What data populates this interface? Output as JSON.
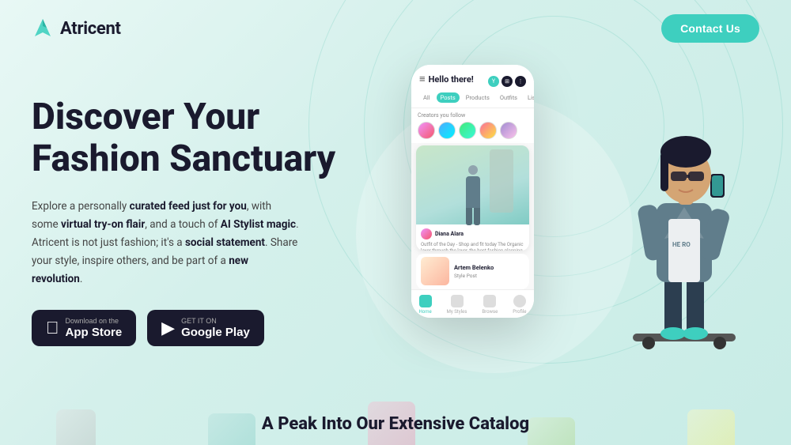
{
  "navbar": {
    "logo_text": "Atricent",
    "contact_button": "Contact Us"
  },
  "hero": {
    "title_line1": "Discover Your",
    "title_line2": "Fashion Sanctuary",
    "description": "Explore a personally curated feed just for you, with some virtual try-on flair, and a touch of AI Stylist magic. Atricent is not just fashion; it's a social statement. Share your style, inspire others, and be part of a new revolution.",
    "description_bold": [
      "curated feed just for you",
      "virtual try-on flair",
      "AI Stylist magic",
      "social statement",
      "new revolution"
    ]
  },
  "store_buttons": {
    "app_store": {
      "pre_label": "Download on the",
      "name": "App Store"
    },
    "google_play": {
      "pre_label": "GET IT ON",
      "name": "Google Play"
    }
  },
  "phone": {
    "greeting": "Hello there!",
    "tabs": [
      "All",
      "Posts",
      "Products",
      "Outfits",
      "List"
    ],
    "active_tab": "Posts",
    "creators_label": "Creators you follow",
    "post_user": "Diana Alara",
    "post_caption": "Outfit of the Day - Shop and fit today The Organic layer through the layer, the best fashion planning your Home harmony",
    "post_user2": "Artem Belenko"
  },
  "bottom": {
    "catalog_heading": "A Peak Into Our Extensive Catalog"
  },
  "colors": {
    "teal": "#3ecfbf",
    "dark": "#1a1a2e",
    "bg_start": "#e8f8f5",
    "bg_end": "#c8ece6"
  }
}
